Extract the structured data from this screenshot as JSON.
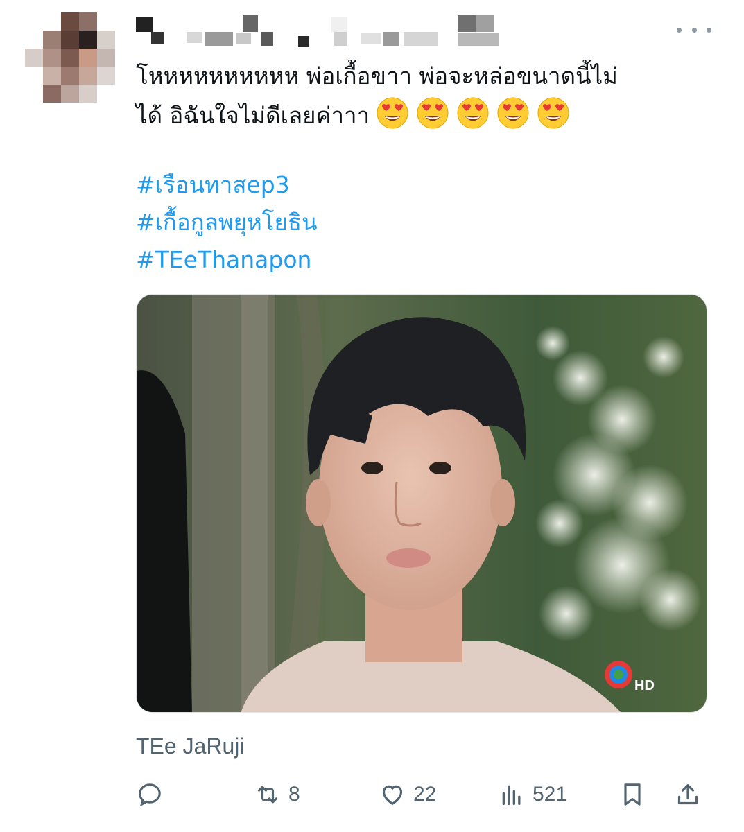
{
  "tweet": {
    "text_line1": "โหหหหหหหหหห พ่อเกื้อขาา พ่อจะหล่อขนาดนี้ไม่",
    "text_line2": "ได้ อิฉันใจไม่ดีเลยค่าาา",
    "emoji_name": "heart-eyes-emoji",
    "emoji_count": 5,
    "hashtags": [
      "#เรือนทาสep3",
      "#เกื้อกูลพยุหโยธิน",
      "#TEeThanapon"
    ],
    "media_caption": "TEe JaRuji",
    "media_logo_text": "HD",
    "colors": {
      "link": "#1d9bf0",
      "muted": "#536471",
      "text": "#0f1419"
    }
  },
  "actions": {
    "reply": {
      "icon": "reply-icon",
      "count": ""
    },
    "retweet": {
      "icon": "retweet-icon",
      "count": "8"
    },
    "like": {
      "icon": "heart-icon",
      "count": "22"
    },
    "views": {
      "icon": "analytics-icon",
      "count": "521"
    },
    "bookmark": {
      "icon": "bookmark-icon",
      "count": ""
    },
    "share": {
      "icon": "share-icon",
      "count": ""
    }
  }
}
